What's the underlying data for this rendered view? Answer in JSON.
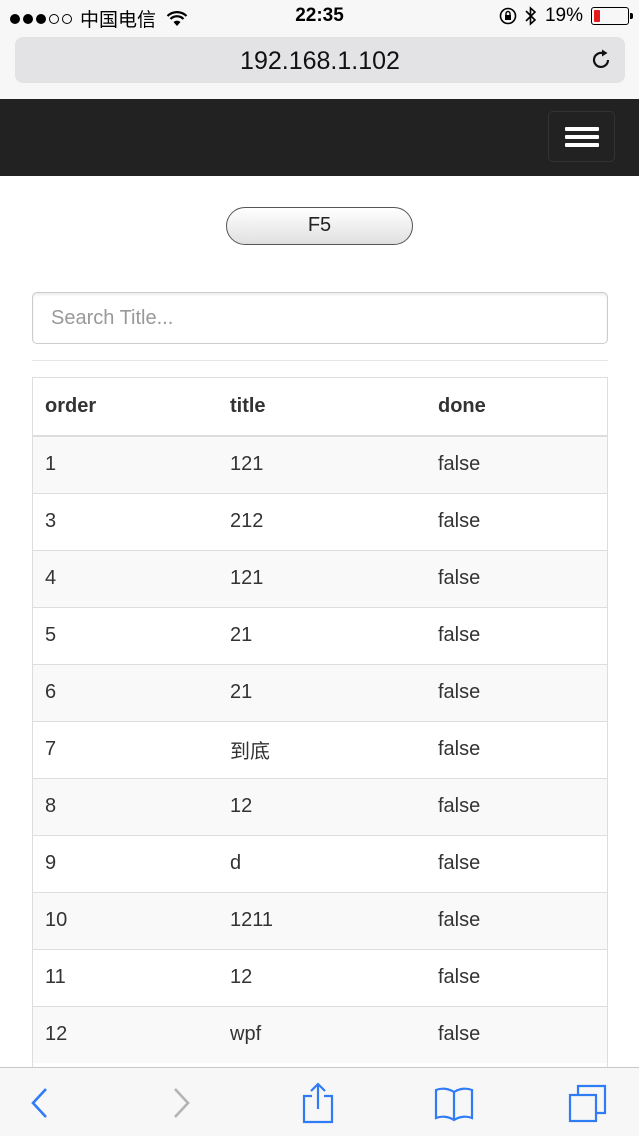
{
  "status_bar": {
    "carrier": "中国电信",
    "time": "22:35",
    "battery_text": "19%",
    "battery_level": 0.19,
    "battery_color": "#e01e1e"
  },
  "address_bar": {
    "url": "192.168.1.102"
  },
  "navbar": {
    "background": "#222222",
    "toggle_icon": "hamburger-menu-icon"
  },
  "content": {
    "refresh_button": "F5",
    "search_placeholder": "Search Title...",
    "table": {
      "headers": [
        "order",
        "title",
        "done"
      ],
      "rows": [
        [
          "1",
          "121",
          "false"
        ],
        [
          "3",
          "212",
          "false"
        ],
        [
          "4",
          "121",
          "false"
        ],
        [
          "5",
          "21",
          "false"
        ],
        [
          "6",
          "21",
          "false"
        ],
        [
          "7",
          "到底",
          "false"
        ],
        [
          "8",
          "12",
          "false"
        ],
        [
          "9",
          "d",
          "false"
        ],
        [
          "10",
          "1211",
          "false"
        ],
        [
          "11",
          "12",
          "false"
        ],
        [
          "12",
          "wpf",
          "false"
        ]
      ]
    }
  },
  "toolbar": {
    "icons": [
      "back-icon",
      "forward-icon",
      "share-icon",
      "bookmarks-icon",
      "tabs-icon"
    ],
    "accent": "#2f7cf6"
  }
}
